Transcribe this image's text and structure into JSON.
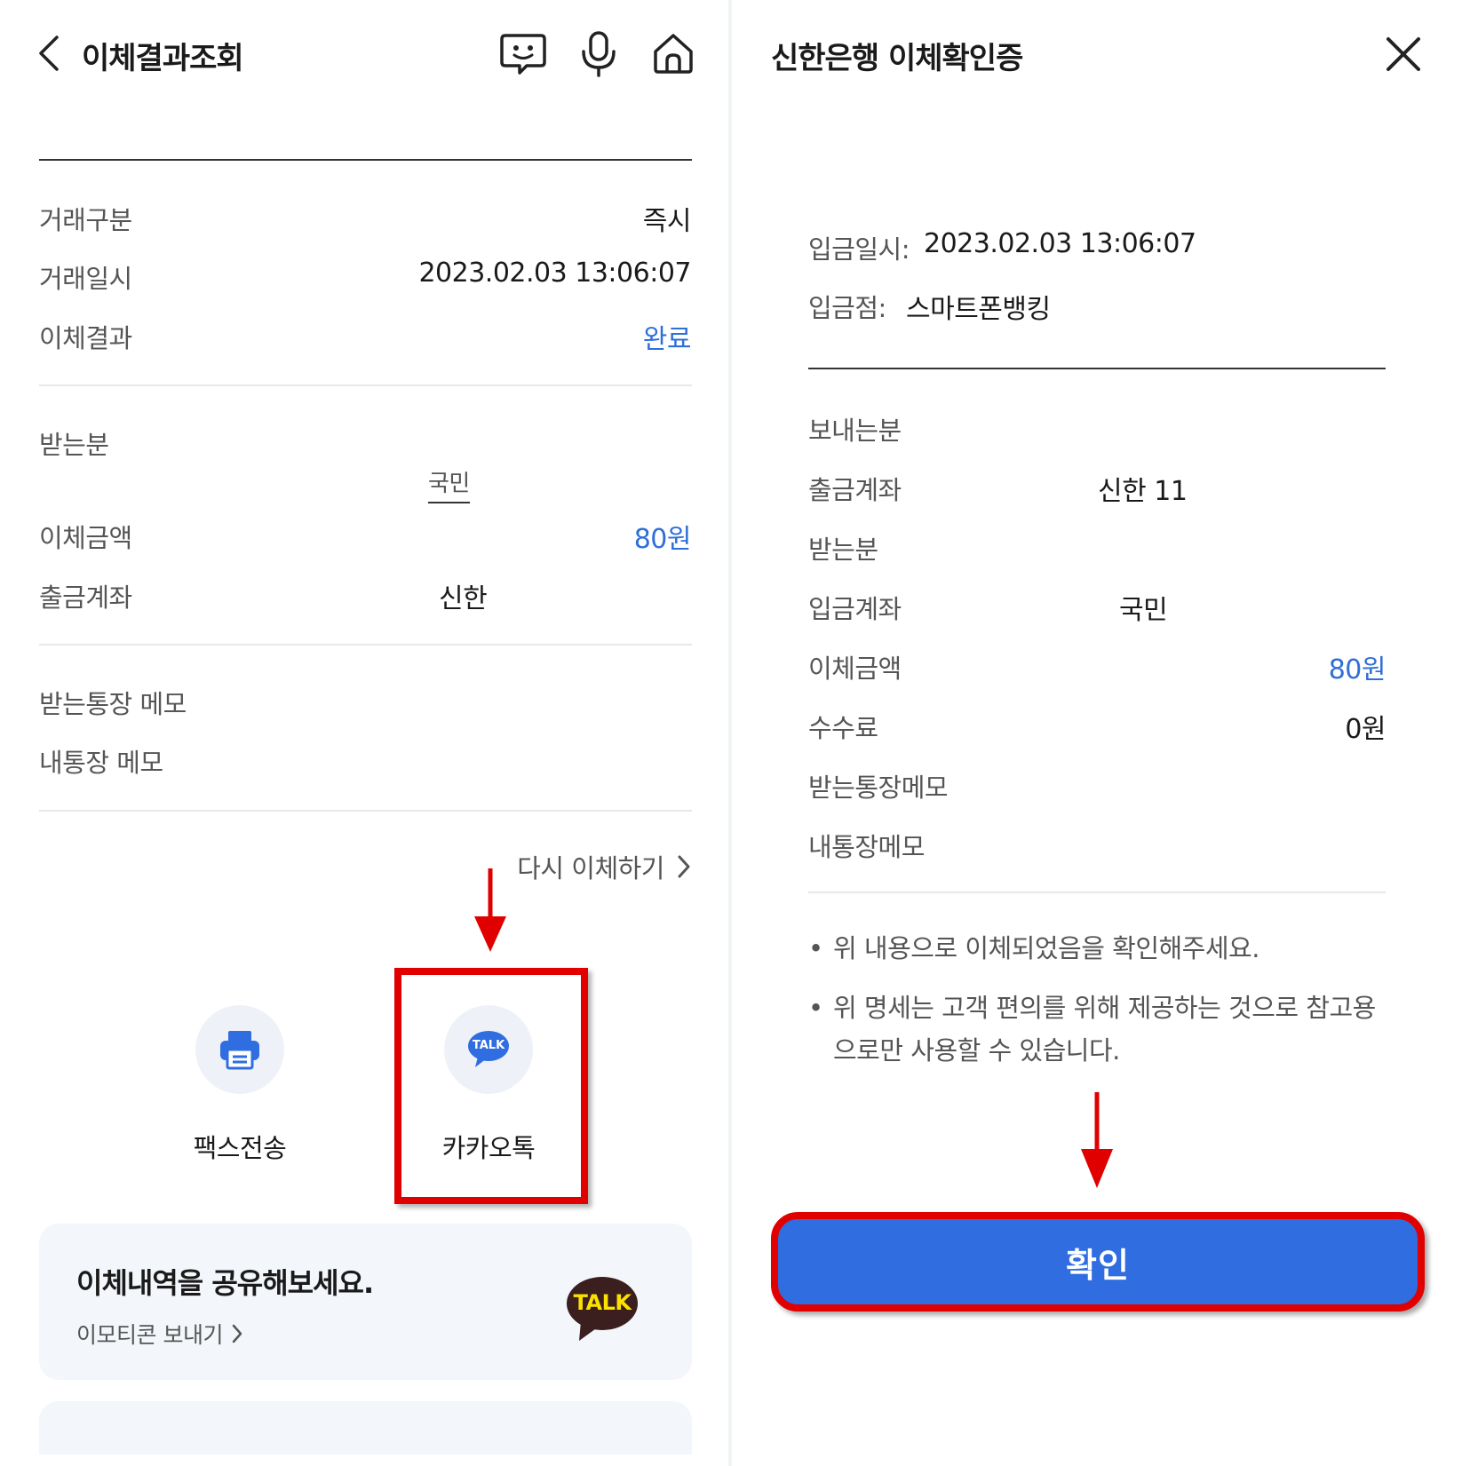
{
  "left": {
    "header": {
      "title": "이체결과조회",
      "back_icon": "chevron-left-icon",
      "chatbot_icon": "chatbot-face-icon",
      "mic_icon": "microphone-icon",
      "home_icon": "home-icon"
    },
    "summary": {
      "rows": [
        {
          "label": "거래구분",
          "value": "즉시"
        },
        {
          "label": "거래일시",
          "value": "2023.02.03 13:06:07"
        },
        {
          "label": "이체결과",
          "value": "완료"
        }
      ]
    },
    "recipient": {
      "label": "받는분",
      "bank": "국민",
      "amount_label": "이체금액",
      "amount_value": "80원",
      "account_label": "출금계좌",
      "account_value": "신한"
    },
    "memo": {
      "recipient_memo_label": "받는통장 메모",
      "my_memo_label": "내통장 메모"
    },
    "retry_label": "다시 이체하기",
    "share_buttons": [
      {
        "label": "팩스전송",
        "icon": "printer-icon"
      },
      {
        "label": "카카오톡",
        "icon": "kakao-talk-icon",
        "icon_text": "TALK"
      }
    ],
    "share_card": {
      "title": "이체내역을 공유해보세요.",
      "link_label": "이모티콘 보내기",
      "badge_text": "TALK"
    }
  },
  "right": {
    "header": {
      "title": "신한은행 이체확인증",
      "close_icon": "close-icon"
    },
    "deposit": {
      "date_label": "입금일시:",
      "date_value": "2023.02.03 13:06:07",
      "branch_label": "입금점:",
      "branch_value": "스마트폰뱅킹"
    },
    "details": [
      {
        "label": "보내는분",
        "value": ""
      },
      {
        "label": "출금계좌",
        "value": "신한 11"
      },
      {
        "label": "받는분",
        "value": ""
      },
      {
        "label": "입금계좌",
        "value": "국민"
      },
      {
        "label": "이체금액",
        "value": "80원"
      },
      {
        "label": "수수료",
        "value": "0원"
      },
      {
        "label": "받는통장메모",
        "value": ""
      },
      {
        "label": "내통장메모",
        "value": ""
      }
    ],
    "notes": [
      "위 내용으로 이체되었음을 확인해주세요.",
      "위 명세는 고객 편의를 위해 제공하는 것으로 참고용",
      "으로만 사용할 수 있습니다."
    ],
    "confirm_label": "확인"
  },
  "colors": {
    "accent_blue": "#2f6fd8",
    "button_blue": "#2f6de0",
    "highlight_red": "#e00000",
    "kakao_dark": "#3b1e1e",
    "kakao_yellow": "#fae100"
  }
}
